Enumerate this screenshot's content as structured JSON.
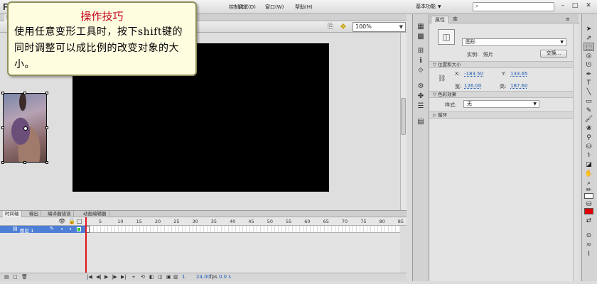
{
  "app": {
    "logo": "F"
  },
  "menu": {
    "items": [
      "控制(O)",
      "调试(D)",
      "窗口(W)",
      "帮助(H)"
    ]
  },
  "workspace": {
    "label": "基本功能"
  },
  "document": {
    "tab": "未"
  },
  "editbar": {
    "zoom": "100%"
  },
  "callout": {
    "title": "操作技巧",
    "body": "使用任意变形工具时，按下shift键的同时调整可以成比例的改变对象的大小。"
  },
  "timeline": {
    "tabs": [
      "时间轴",
      "输出",
      "编译器错误",
      "动画编辑器"
    ],
    "ruler": [
      "5",
      "10",
      "15",
      "20",
      "25",
      "30",
      "35",
      "40",
      "45",
      "50",
      "55",
      "60",
      "65",
      "70",
      "75",
      "80",
      "85"
    ],
    "layer": {
      "name": "图层 1",
      "color": "#26c926"
    },
    "footer": {
      "current_frame": "1",
      "fps": "24.00",
      "fps_unit": "fps",
      "time": "0.0 s"
    }
  },
  "properties": {
    "tabs": [
      "属性",
      "库"
    ],
    "symbol_type": "图形",
    "instance_label": "实例:",
    "instance_name": "照片",
    "swap_button": "交换...",
    "position_section": "位置和大小",
    "x_label": "X:",
    "x_value": "-183.50",
    "y_label": "Y:",
    "y_value": "133.65",
    "w_label": "宽:",
    "w_value": "126.00",
    "h_label": "高:",
    "h_value": "187.60",
    "color_section": "色彩效果",
    "style_label": "样式:",
    "style_value": "无",
    "loop_section": "循环"
  },
  "colors": {
    "accent": "#4d7fd6",
    "callout_title": "#c0001a",
    "fill": "#e00000",
    "stroke": "#ffffff"
  }
}
